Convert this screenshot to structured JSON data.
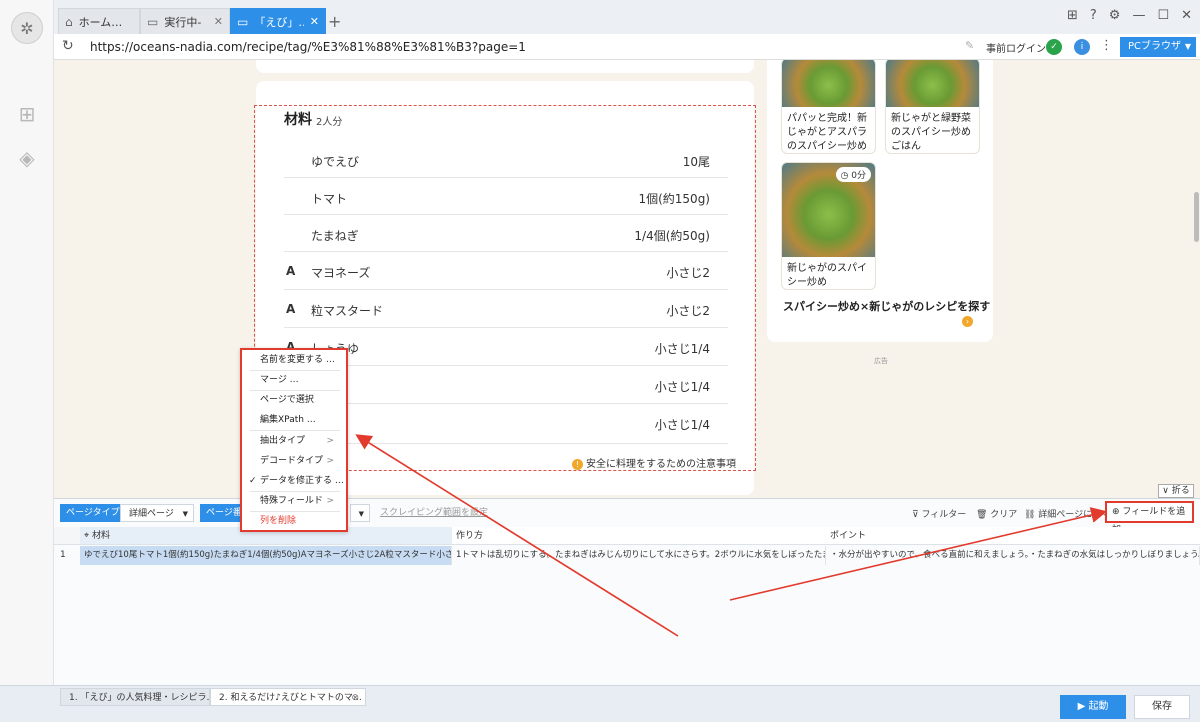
{
  "browser": {
    "tabs": [
      {
        "label": "ホーム…",
        "icon": "home-icon"
      },
      {
        "label": "実行中-「…",
        "icon": "page-icon"
      },
      {
        "label": "「えび」…",
        "icon": "page-icon"
      }
    ],
    "url": "https://oceans-nadia.com/recipe/tag/%E3%81%88%E3%81%B3?page=1",
    "login_label": "事前ログイン",
    "mode_button": "PCブラウザ"
  },
  "recipe": {
    "title": "材料",
    "servings": "2人分",
    "ingredients": [
      {
        "mark": "",
        "name": "ゆでえび",
        "amount": "10尾"
      },
      {
        "mark": "",
        "name": "トマト",
        "amount": "1個(約150g)"
      },
      {
        "mark": "",
        "name": "たまねぎ",
        "amount": "1/4個(約50g)"
      },
      {
        "mark": "A",
        "name": "マヨネーズ",
        "amount": "小さじ2"
      },
      {
        "mark": "A",
        "name": "粒マスタード",
        "amount": "小さじ2"
      },
      {
        "mark": "A",
        "name": "しょうゆ",
        "amount": "小さじ1/4"
      },
      {
        "mark": "",
        "name": "",
        "amount": "小さじ1/4"
      },
      {
        "mark": "",
        "name": "",
        "amount": "小さじ1/4"
      }
    ],
    "safety_note": "安全に料理をするための注意事項"
  },
  "sidebar": {
    "cards": [
      {
        "caption": "パパッと完成！新じゃがとアスパラのスパイシー炒め"
      },
      {
        "caption": "新じゃがと緑野菜のスパイシー炒めごはん"
      },
      {
        "caption": "新じゃがのスパイシー炒め",
        "timer": "0分"
      }
    ],
    "search_link": "スパイシー炒め×新じゃがのレシピを探す",
    "ad_label": "広告"
  },
  "panel": {
    "fold_label": "折る",
    "page_type_label": "ページタイプ",
    "page_type_value": "詳細ページ",
    "page_num_label": "ページ番号",
    "scrape_range": "スクレイピング範囲を設定",
    "filter": "フィルター",
    "clear": "クリア",
    "goto_detail": "詳細ページに行く",
    "add_field": "フィールドを追加",
    "columns": [
      "材料",
      "作り方",
      "ポイント"
    ],
    "row_number": "1",
    "row": [
      "ゆでえび10尾トマト1個(約150g)たまねぎ1/4個(約50g)Aマヨネーズ小さじ2A粒マスタード小さじ2A…",
      "1トマトは乱切りにする。たまねぎはみじん切りにして水にさらす。2ボウルに水気をしぼったたま…",
      "・水分が出やすいので、食べる直前に和えましょう。・たまねぎの水気はしっかりしぼりましょう。"
    ]
  },
  "context_menu": [
    {
      "label": "名前を変更する …"
    },
    {
      "label": "マージ …"
    },
    {
      "label": "ページで選択"
    },
    {
      "label": "編集XPath …"
    },
    {
      "label": "抽出タイプ",
      "submenu": true
    },
    {
      "label": "デコードタイプ",
      "submenu": true
    },
    {
      "label": "データを修正する …",
      "checked": true
    },
    {
      "label": "特殊フィールド",
      "submenu": true
    },
    {
      "label": "列を削除",
      "danger": true
    }
  ],
  "status": {
    "tabs": [
      "1. 「えび」の人気料理・レシピラ…",
      "2. 和えるだけ♪えびとトマトのマ…"
    ],
    "start_button": "起動",
    "save_button": "保存"
  },
  "colors": {
    "accent": "#2e8fe8",
    "highlight": "#e23b2e",
    "selection": "#c7dcf2"
  }
}
